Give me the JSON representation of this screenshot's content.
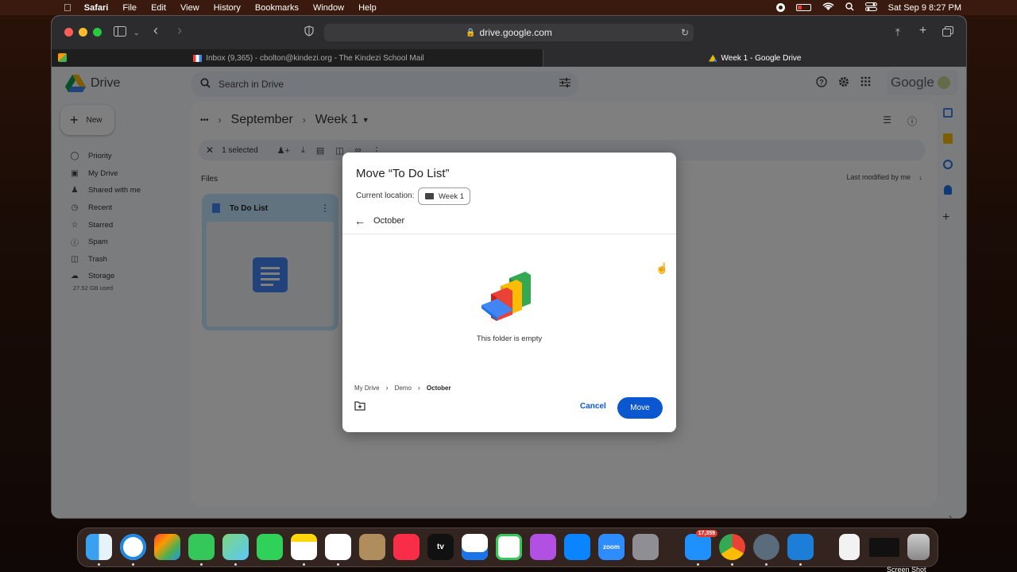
{
  "menubar": {
    "app": "Safari",
    "items": [
      "File",
      "Edit",
      "View",
      "History",
      "Bookmarks",
      "Window",
      "Help"
    ],
    "datetime": "Sat Sep 9  8:27 PM"
  },
  "browser": {
    "url": "drive.google.com",
    "tabs": [
      {
        "title": "Inbox (9,365) - cbolton@kindezi.org - The Kindezi School Mail"
      },
      {
        "title": "Week 1 - Google Drive"
      }
    ]
  },
  "drive": {
    "logo_text": "Drive",
    "search_placeholder": "Search in Drive",
    "google_label": "Google",
    "new_label": "New",
    "nav": [
      {
        "label": "Priority",
        "icon": "check-circle-icon"
      },
      {
        "label": "My Drive",
        "icon": "drive-icon"
      },
      {
        "label": "Shared with me",
        "icon": "people-icon"
      },
      {
        "label": "Recent",
        "icon": "clock-icon"
      },
      {
        "label": "Starred",
        "icon": "star-icon"
      },
      {
        "label": "Spam",
        "icon": "spam-icon"
      },
      {
        "label": "Trash",
        "icon": "trash-icon"
      },
      {
        "label": "Storage",
        "icon": "cloud-icon"
      }
    ],
    "storage_used": "27.52 GB used",
    "breadcrumb": {
      "ellipsis": "•••",
      "parent": "September",
      "current": "Week 1"
    },
    "selection": {
      "count_label": "1 selected"
    },
    "files_heading": "Files",
    "sort_label": "Last modified by me",
    "file": {
      "name": "To Do List"
    }
  },
  "dialog": {
    "title": "Move “To Do List”",
    "current_location_label": "Current location:",
    "current_location": "Week 1",
    "folder_name": "October",
    "empty_message": "This folder is empty",
    "path": [
      "My Drive",
      "Demo",
      "October"
    ],
    "cancel_label": "Cancel",
    "move_label": "Move"
  },
  "dock": {
    "mail_badge": "17,359",
    "zoom_label": "zoom",
    "tv_label": "tv",
    "screenshot_label": "Screen Shot"
  },
  "colors": {
    "primary_blue": "#0b57d0",
    "selected_card": "#c2e7ff",
    "docs_blue": "#4285f4"
  }
}
